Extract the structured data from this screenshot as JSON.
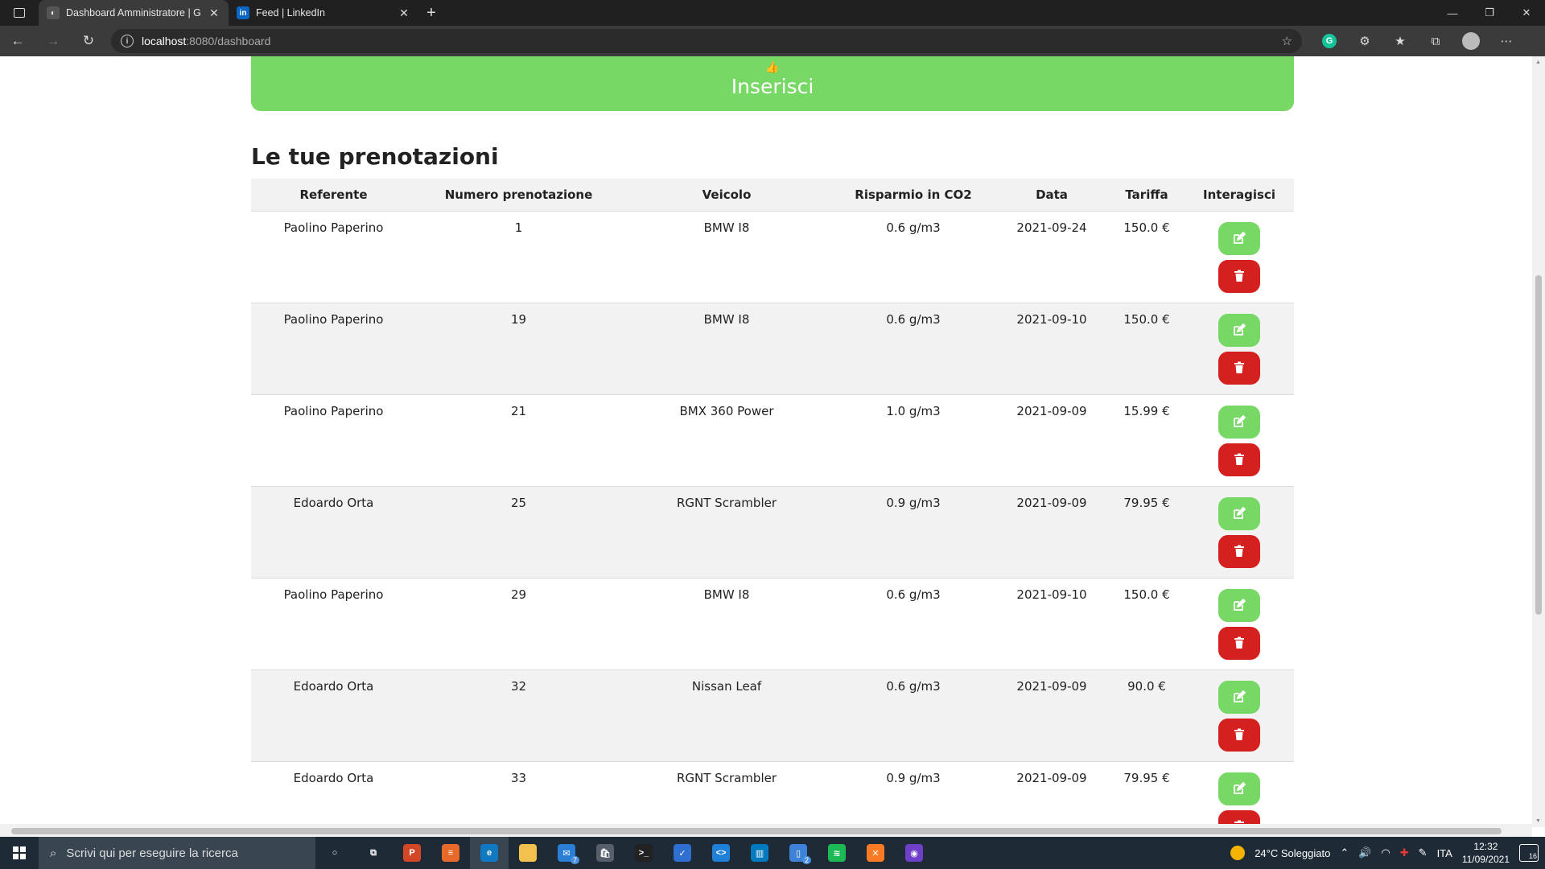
{
  "browser": {
    "tabs": [
      {
        "title": "Dashboard Amministratore | Gre",
        "favicon_color": "#444444",
        "active": true
      },
      {
        "title": "Feed | LinkedIn",
        "favicon_color": "#0a66c2",
        "favicon_text": "in",
        "active": false
      }
    ],
    "url_host": "localhost",
    "url_rest": ":8080/dashboard"
  },
  "page": {
    "insert_button_label": "Inserisci",
    "section_title": "Le tue prenotazioni",
    "accent_green": "#77d866",
    "danger_red": "#d4211f",
    "table": {
      "headers": [
        "Referente",
        "Numero prenotazione",
        "Veicolo",
        "Risparmio in CO2",
        "Data",
        "Tariffa",
        "Interagisci"
      ],
      "rows": [
        {
          "referente": "Paolino Paperino",
          "numero": "1",
          "veicolo": "BMW I8",
          "co2": "0.6 g/m3",
          "data": "2021-09-24",
          "tariffa": "150.0 €"
        },
        {
          "referente": "Paolino Paperino",
          "numero": "19",
          "veicolo": "BMW I8",
          "co2": "0.6 g/m3",
          "data": "2021-09-10",
          "tariffa": "150.0 €"
        },
        {
          "referente": "Paolino Paperino",
          "numero": "21",
          "veicolo": "BMX 360 Power",
          "co2": "1.0 g/m3",
          "data": "2021-09-09",
          "tariffa": "15.99 €"
        },
        {
          "referente": "Edoardo Orta",
          "numero": "25",
          "veicolo": "RGNT Scrambler",
          "co2": "0.9 g/m3",
          "data": "2021-09-09",
          "tariffa": "79.95 €"
        },
        {
          "referente": "Paolino Paperino",
          "numero": "29",
          "veicolo": "BMW I8",
          "co2": "0.6 g/m3",
          "data": "2021-09-10",
          "tariffa": "150.0 €"
        },
        {
          "referente": "Edoardo Orta",
          "numero": "32",
          "veicolo": "Nissan Leaf",
          "co2": "0.6 g/m3",
          "data": "2021-09-09",
          "tariffa": "90.0 €"
        },
        {
          "referente": "Edoardo Orta",
          "numero": "33",
          "veicolo": "RGNT Scrambler",
          "co2": "0.9 g/m3",
          "data": "2021-09-09",
          "tariffa": "79.95 €"
        }
      ]
    }
  },
  "taskbar": {
    "search_placeholder": "Scrivi qui per eseguire la ricerca",
    "apps": [
      {
        "name": "cortana-icon",
        "color": "#1f2a37",
        "text": "○"
      },
      {
        "name": "task-view-icon",
        "color": "#1f2a37",
        "text": "⧉"
      },
      {
        "name": "powerpoint-icon",
        "color": "#d24726",
        "text": "P"
      },
      {
        "name": "hamburger-app-icon",
        "color": "#e86a2a",
        "text": "≡"
      },
      {
        "name": "edge-icon",
        "color": "#0f7ac2",
        "text": "e",
        "active": true
      },
      {
        "name": "file-explorer-icon",
        "color": "#f2c14e",
        "text": ""
      },
      {
        "name": "mail-icon",
        "color": "#2a7fd4",
        "text": "✉",
        "badge": "7"
      },
      {
        "name": "store-icon",
        "color": "#555e6a",
        "text": "🛍"
      },
      {
        "name": "terminal-icon",
        "color": "#222222",
        "text": ">_"
      },
      {
        "name": "todo-icon",
        "color": "#2f6fd1",
        "text": "✓"
      },
      {
        "name": "vscode-icon",
        "color": "#1e80d6",
        "text": "<>"
      },
      {
        "name": "trello-icon",
        "color": "#0079bf",
        "text": "▥"
      },
      {
        "name": "phone-link-icon",
        "color": "#3d82d6",
        "text": "▯",
        "badge": "2"
      },
      {
        "name": "spotify-icon",
        "color": "#1db954",
        "text": "≋"
      },
      {
        "name": "xampp-icon",
        "color": "#fb7a24",
        "text": "✕"
      },
      {
        "name": "github-icon",
        "color": "#6e40c9",
        "text": "◉"
      }
    ],
    "weather": "24°C  Soleggiato",
    "language": "ITA",
    "time": "12:32",
    "date": "11/09/2021",
    "notifications": "16"
  }
}
